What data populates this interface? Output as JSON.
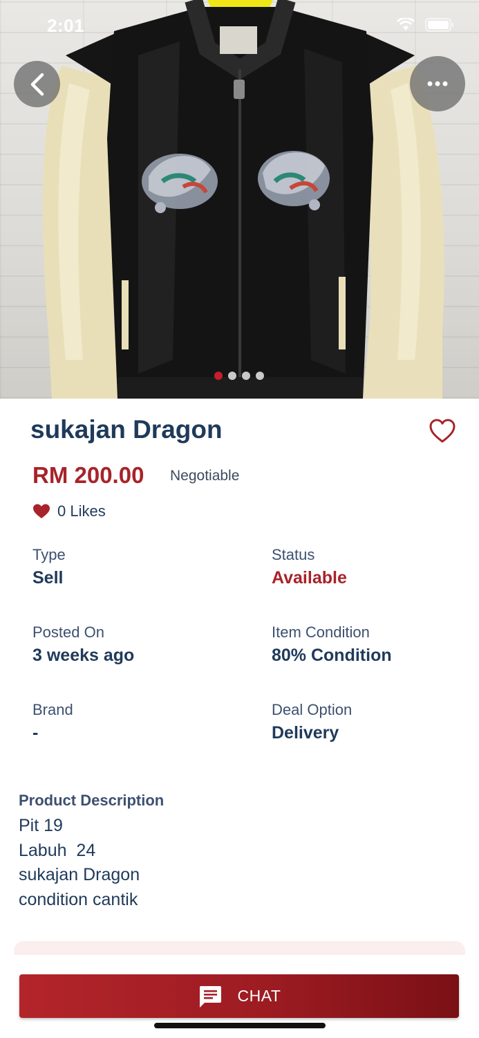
{
  "status_bar": {
    "time": "2:01"
  },
  "gallery": {
    "image_count": 4,
    "active_index": 0
  },
  "product": {
    "title": "sukajan Dragon",
    "price": "RM 200.00",
    "price_note": "Negotiable",
    "likes": "0 Likes"
  },
  "attributes": {
    "type": {
      "label": "Type",
      "value": "Sell"
    },
    "status": {
      "label": "Status",
      "value": "Available"
    },
    "posted_on": {
      "label": "Posted On",
      "value": "3 weeks ago"
    },
    "item_condition": {
      "label": "Item Condition",
      "value": "80% Condition"
    },
    "brand": {
      "label": "Brand",
      "value": "-"
    },
    "deal_option": {
      "label": "Deal Option",
      "value": "Delivery"
    }
  },
  "description": {
    "title": "Product Description",
    "lines": [
      "Pit 19",
      "Labuh  24",
      "sukajan Dragon",
      "condition cantik"
    ]
  },
  "actions": {
    "chat_label": "CHAT"
  },
  "colors": {
    "accent_red": "#a8232a",
    "navy_text": "#1f3a5a",
    "dot_active": "#c41f2a"
  },
  "icons": {
    "back": "chevron-left-icon",
    "more": "ellipsis-icon",
    "favorite": "heart-outline-icon",
    "likes": "heart-filled-icon",
    "chat": "message-icon"
  }
}
